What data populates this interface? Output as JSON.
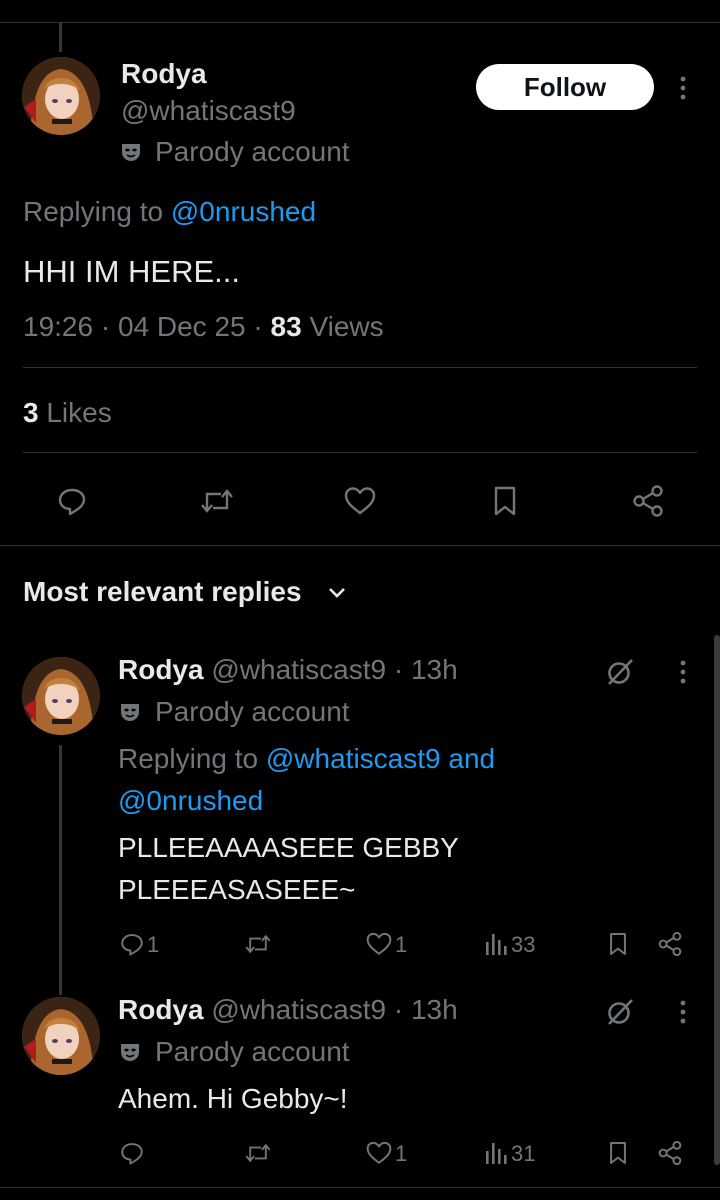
{
  "main_post": {
    "display_name": "Rodya",
    "handle": "@whatiscast9",
    "parody_label": "Parody account",
    "follow_label": "Follow",
    "replying_prefix": "Replying to ",
    "replying_to": "@0nrushed",
    "text": "HHI IM HERE...",
    "time": "19:26",
    "date": "04 Dec 25",
    "dot": "·",
    "views_count": "83",
    "views_label": "Views",
    "likes_count": "3",
    "likes_label": "Likes"
  },
  "replies_header": {
    "label": "Most relevant replies"
  },
  "replies": [
    {
      "display_name": "Rodya",
      "handle": "@whatiscast9",
      "time_ago": "· 13h",
      "parody_label": "Parody account",
      "replying_prefix": "Replying to ",
      "replying_to_1": "@whatiscast9",
      "replying_and": "and",
      "replying_to_2": "@0nrushed",
      "text_line1": "PLLEEAAAASEEE GEBBY",
      "text_line2": "PLEEEASASEEE~",
      "reply_count": "1",
      "like_count": "1",
      "views": "33"
    },
    {
      "display_name": "Rodya",
      "handle": "@whatiscast9",
      "time_ago": "· 13h",
      "parody_label": "Parody account",
      "text": "Ahem. Hi Gebby~!",
      "like_count": "1",
      "views": "31"
    }
  ],
  "colors": {
    "background": "#000000",
    "text": "#e7e9ea",
    "muted": "#71767b",
    "link": "#1d9bf0",
    "divider": "#2f3336"
  },
  "icons": [
    "more-icon",
    "mask-icon",
    "reply-icon",
    "repost-icon",
    "like-icon",
    "bookmark-icon",
    "share-icon",
    "views-icon",
    "grok-icon",
    "chevron-down-icon"
  ]
}
